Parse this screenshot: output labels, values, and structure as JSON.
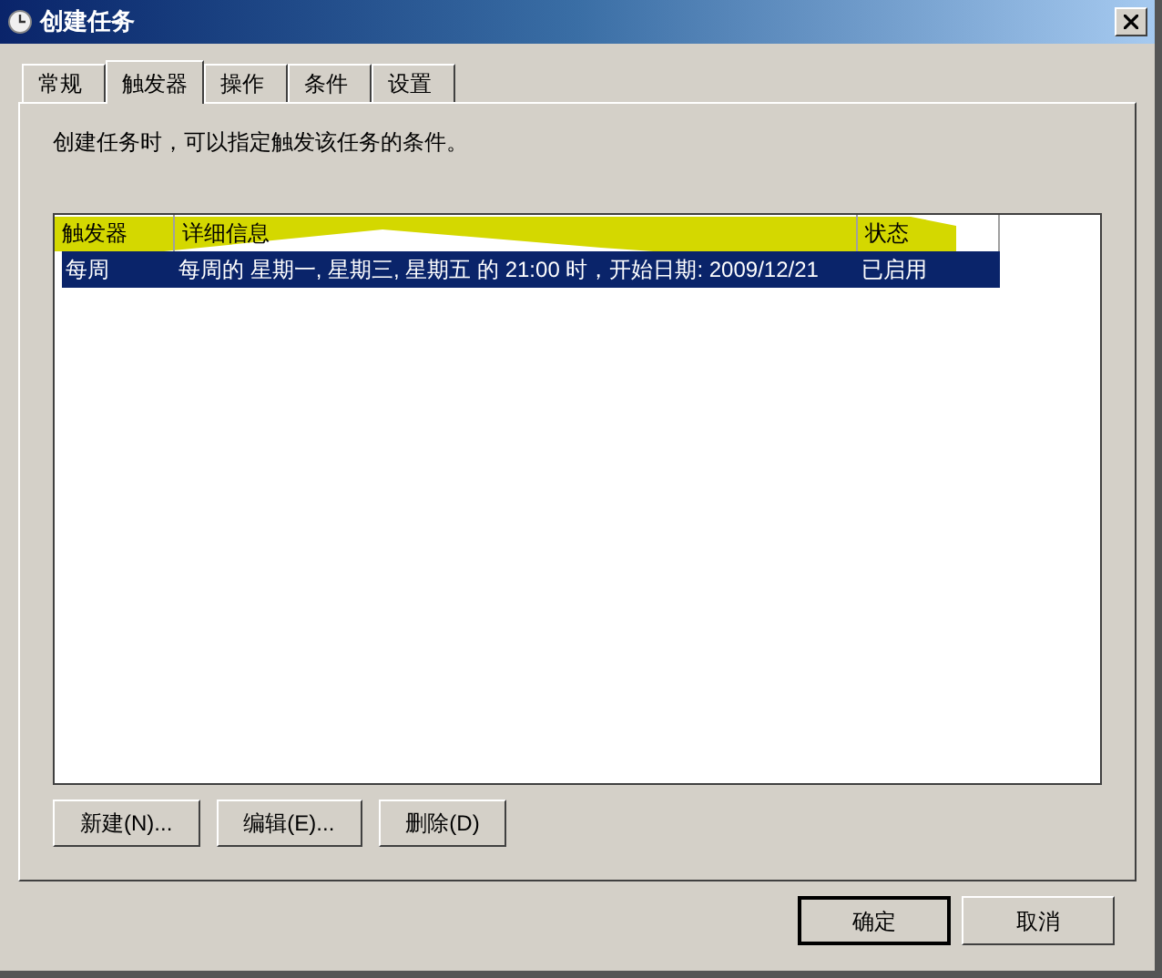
{
  "window": {
    "title": "创建任务"
  },
  "tabs": [
    {
      "label": "常规",
      "selected": false
    },
    {
      "label": "触发器",
      "selected": true
    },
    {
      "label": "操作",
      "selected": false
    },
    {
      "label": "条件",
      "selected": false
    },
    {
      "label": "设置",
      "selected": false
    }
  ],
  "description": "创建任务时，可以指定触发该任务的条件。",
  "table": {
    "columns": [
      "触发器",
      "详细信息",
      "状态"
    ],
    "rows": [
      {
        "cells": [
          "每周",
          "每周的 星期一, 星期三, 星期五 的 21:00 时，开始日期: 2009/12/21",
          "已启用"
        ],
        "selected": true
      }
    ]
  },
  "list_buttons": [
    "新建(N)...",
    "编辑(E)...",
    "删除(D)"
  ],
  "dialog_buttons": [
    {
      "label": "确定",
      "default": true
    },
    {
      "label": "取消",
      "default": false
    }
  ]
}
